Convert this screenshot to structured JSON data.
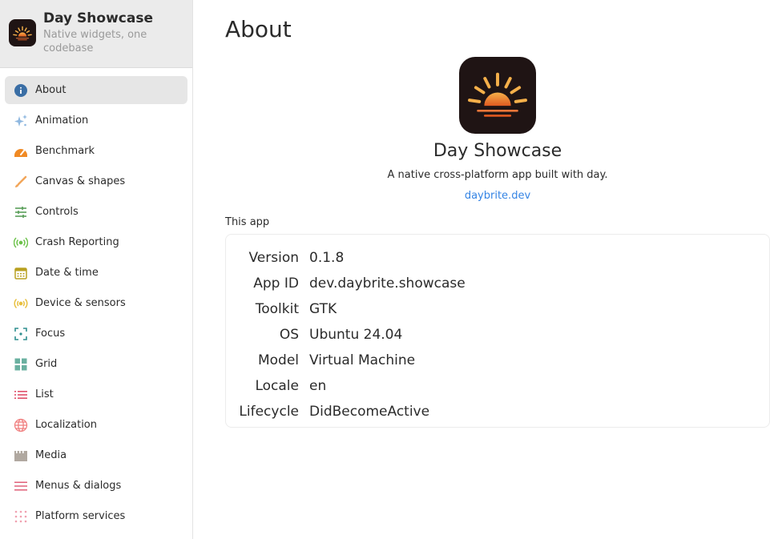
{
  "app": {
    "title": "Day Showcase",
    "subtitle": "Native widgets, one codebase"
  },
  "sidebar": {
    "items": [
      {
        "label": "About",
        "icon": "info-icon",
        "color": "#3a6ea5",
        "selected": true
      },
      {
        "label": "Animation",
        "icon": "sparkles-icon",
        "color": "#8fb8e0"
      },
      {
        "label": "Benchmark",
        "icon": "speedometer-icon",
        "color": "#f08a24"
      },
      {
        "label": "Canvas & shapes",
        "icon": "brush-icon",
        "color": "#f2a65a"
      },
      {
        "label": "Controls",
        "icon": "sliders-icon",
        "color": "#5a9e5a"
      },
      {
        "label": "Crash Reporting",
        "icon": "broadcast-icon",
        "color": "#6cc24a"
      },
      {
        "label": "Date & time",
        "icon": "calendar-icon",
        "color": "#b8a020"
      },
      {
        "label": "Device & sensors",
        "icon": "sensor-icon",
        "color": "#e8c040"
      },
      {
        "label": "Focus",
        "icon": "focus-icon",
        "color": "#2f8f8f"
      },
      {
        "label": "Grid",
        "icon": "grid-icon",
        "color": "#6ab0a0"
      },
      {
        "label": "List",
        "icon": "list-icon",
        "color": "#e0506a"
      },
      {
        "label": "Localization",
        "icon": "globe-icon",
        "color": "#f08080"
      },
      {
        "label": "Media",
        "icon": "film-icon",
        "color": "#b0a8a0"
      },
      {
        "label": "Menus & dialogs",
        "icon": "menu-icon",
        "color": "#e0607a"
      },
      {
        "label": "Platform services",
        "icon": "dots-grid-icon",
        "color": "#f0a0b0"
      }
    ]
  },
  "main": {
    "title": "About",
    "app_name": "Day Showcase",
    "description": "A native cross-platform app built with day.",
    "link": "daybrite.dev",
    "section_label": "This app",
    "info": [
      {
        "key": "Version",
        "value": "0.1.8"
      },
      {
        "key": "App ID",
        "value": "dev.daybrite.showcase"
      },
      {
        "key": "Toolkit",
        "value": "GTK"
      },
      {
        "key": "OS",
        "value": "Ubuntu 24.04"
      },
      {
        "key": "Model",
        "value": "Virtual Machine"
      },
      {
        "key": "Locale",
        "value": "en"
      },
      {
        "key": "Lifecycle",
        "value": "DidBecomeActive"
      }
    ]
  },
  "colors": {
    "accent": "#3584e4",
    "icon_bg": "#1f1414",
    "sun_top": "#f5b04a",
    "sun_bottom": "#e05a20"
  }
}
